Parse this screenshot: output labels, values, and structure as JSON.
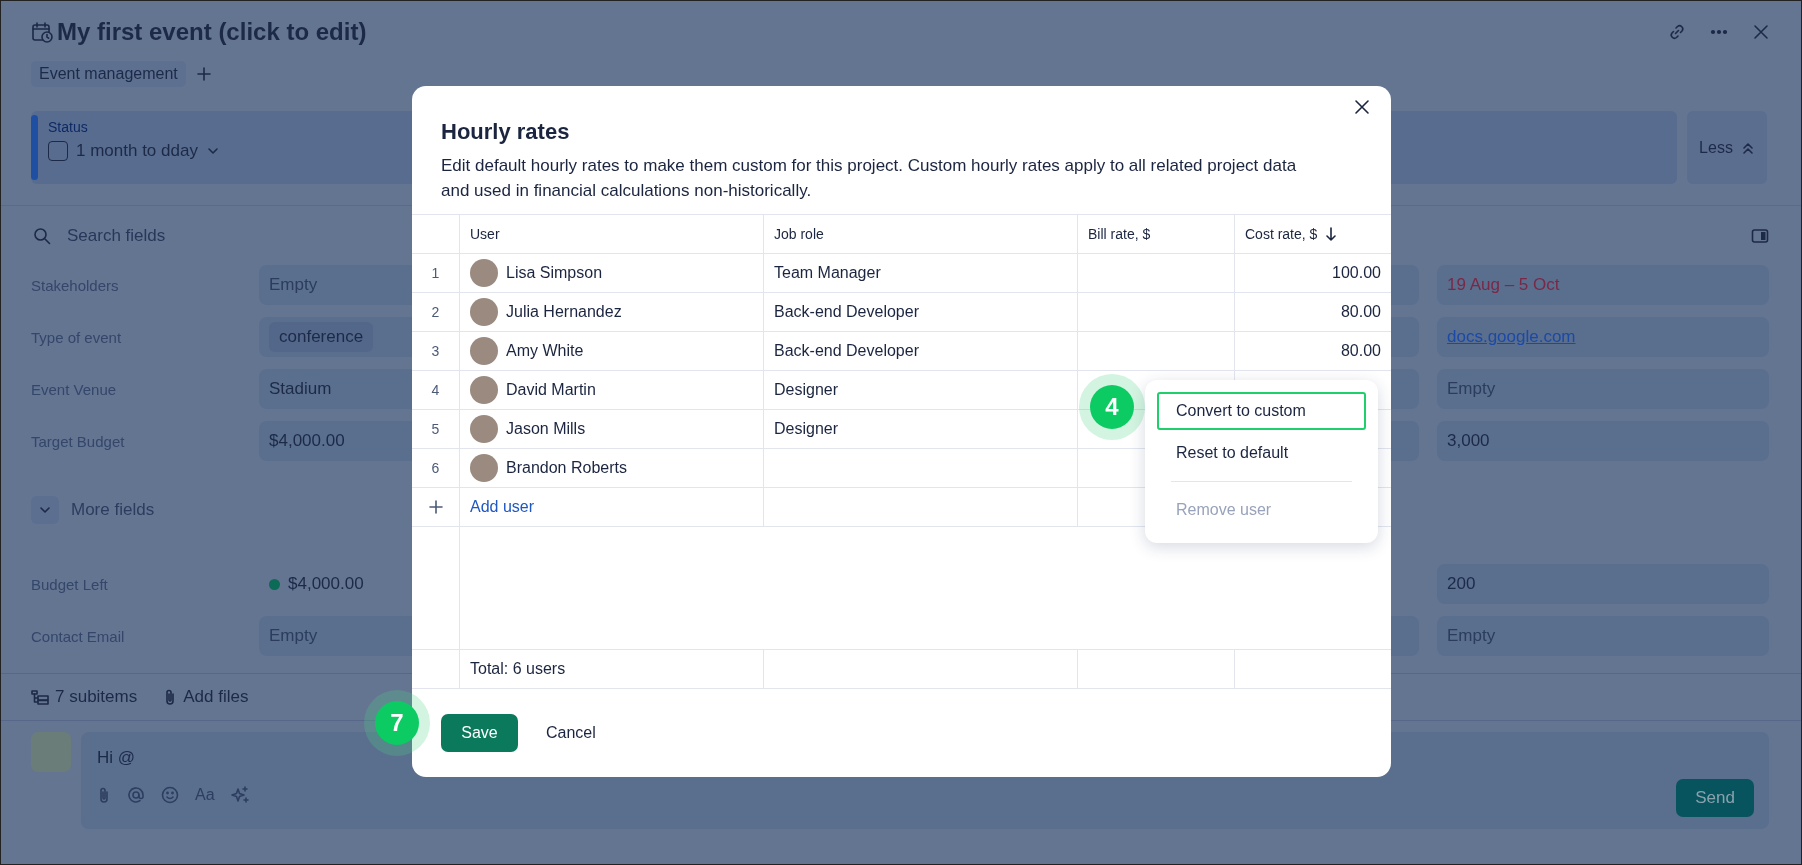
{
  "header": {
    "title": "My first event (click to edit)"
  },
  "tags": [
    "Event management"
  ],
  "status": {
    "label": "Status",
    "value": "1 month to dday",
    "checked": false
  },
  "less_button": "Less",
  "search": {
    "placeholder": "Search fields"
  },
  "fields": [
    {
      "label": "Stakeholders",
      "value": "Empty",
      "kind": "empty",
      "right": {
        "value": "19 Aug – 5 Oct",
        "kind": "date"
      }
    },
    {
      "label": "Type of event",
      "value": "conference",
      "kind": "tag",
      "right": {
        "value": "docs.google.com",
        "kind": "link"
      }
    },
    {
      "label": "Event Venue",
      "value": "Stadium",
      "kind": "text",
      "right": {
        "value": "Empty",
        "kind": "empty"
      }
    },
    {
      "label": "Target Budget",
      "value": "$4,000.00",
      "kind": "text",
      "right": {
        "value": "3,000",
        "kind": "text"
      }
    }
  ],
  "more_fields": "More fields",
  "extra_fields": [
    {
      "label": "Budget Left",
      "value": "$4,000.00",
      "kind": "dot",
      "right": {
        "value": "200",
        "kind": "text"
      }
    },
    {
      "label": "Contact Email",
      "value": "Empty",
      "kind": "empty",
      "right": {
        "value": "Empty",
        "kind": "empty"
      }
    }
  ],
  "footer": {
    "subitems": "7 subitems",
    "add_files": "Add files"
  },
  "comment": {
    "value": "Hi @",
    "format_label": "Aa",
    "send": "Send"
  },
  "modal": {
    "title": "Hourly rates",
    "description": "Edit default hourly rates to make them custom for this project. Custom hourly rates apply to all related project data and used in financial calculations non-historically.",
    "columns": [
      {
        "label": "User",
        "sorted_descending": false
      },
      {
        "label": "Job role",
        "sorted_descending": false
      },
      {
        "label": "Bill rate, $",
        "sorted_descending": false
      },
      {
        "label": "Cost rate, $",
        "sorted_descending": true
      }
    ],
    "rows": [
      {
        "index": "1",
        "user": "Lisa Simpson",
        "job_role": "Team Manager",
        "cost_rate": "100.00"
      },
      {
        "index": "2",
        "user": "Julia Hernandez",
        "job_role": "Back-end Developer",
        "cost_rate": "80.00"
      },
      {
        "index": "3",
        "user": "Amy White",
        "job_role": "Back-end Developer",
        "cost_rate": "80.00"
      },
      {
        "index": "4",
        "user": "David Martin",
        "job_role": "Designer"
      },
      {
        "index": "5",
        "user": "Jason Mills",
        "job_role": "Designer"
      },
      {
        "index": "6",
        "user": "Brandon Roberts"
      }
    ],
    "add_user": "Add user",
    "total": "Total: 6 users",
    "save": "Save",
    "cancel": "Cancel"
  },
  "context_menu": {
    "items": [
      {
        "label": "Convert to custom",
        "selected": true,
        "disabled": false,
        "divider_before": false
      },
      {
        "label": "Reset to default",
        "selected": false,
        "disabled": false,
        "divider_before": false
      },
      {
        "label": "Remove user",
        "selected": false,
        "disabled": true,
        "divider_before": true
      }
    ]
  },
  "step_badges": [
    {
      "label": "4"
    },
    {
      "label": "7"
    }
  ]
}
